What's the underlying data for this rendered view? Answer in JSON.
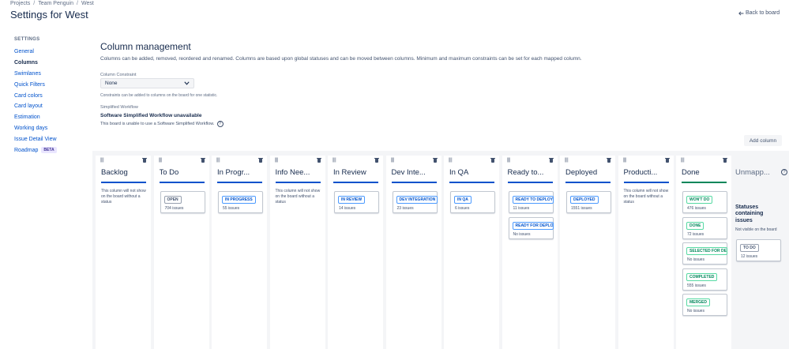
{
  "breadcrumb": [
    "Projects",
    "Team Penguin",
    "West"
  ],
  "breadcrumb_sep": "/",
  "page_title": "Settings for West",
  "back_link": {
    "icon": "arrow-left-icon",
    "label": "Back to board"
  },
  "sidebar": {
    "heading": "SETTINGS",
    "items": [
      {
        "label": "General"
      },
      {
        "label": "Columns",
        "active": true
      },
      {
        "label": "Swimlanes"
      },
      {
        "label": "Quick Filters"
      },
      {
        "label": "Card colors"
      },
      {
        "label": "Card layout"
      },
      {
        "label": "Estimation"
      },
      {
        "label": "Working days"
      },
      {
        "label": "Issue Detail View"
      },
      {
        "label": "Roadmap",
        "badge": "BETA"
      }
    ]
  },
  "main": {
    "title": "Column management",
    "description": "Columns can be added, removed, reordered and renamed. Columns are based upon global statuses and can be moved between columns. Minimum and maximum constraints can be set for each mapped column.",
    "constraint_label": "Column Constraint",
    "constraint_value": "None",
    "constraint_help": "Constraints can be added to columns on the board for one statistic.",
    "workflow_label": "Simplified Workflow",
    "workflow_title": "Software Simplified Workflow unavailable",
    "workflow_text": "This board is unable to use a Software Simplified Workflow.",
    "add_column": "Add column"
  },
  "columns": [
    {
      "title": "Backlog",
      "note": "This column will not show on the board without a status",
      "statuses": []
    },
    {
      "title": "To Do",
      "statuses": [
        {
          "label": "OPEN",
          "count": "704 issues",
          "kind": "todo"
        }
      ]
    },
    {
      "title": "In Progr...",
      "statuses": [
        {
          "label": "IN PROGRESS",
          "count": "55 issues",
          "kind": "prog"
        }
      ]
    },
    {
      "title": "Info Nee...",
      "note": "This column will not show on the board without a status",
      "statuses": []
    },
    {
      "title": "In Review",
      "statuses": [
        {
          "label": "IN REVIEW",
          "count": "14 issues",
          "kind": "prog"
        }
      ]
    },
    {
      "title": "Dev Inte...",
      "statuses": [
        {
          "label": "DEV INTEGRATION",
          "count": "23 issues",
          "kind": "prog"
        }
      ]
    },
    {
      "title": "In QA",
      "statuses": [
        {
          "label": "IN QA",
          "count": "6 issues",
          "kind": "prog"
        }
      ]
    },
    {
      "title": "Ready to...",
      "statuses": [
        {
          "label": "READY TO DEPLOY",
          "count": "11 issues",
          "kind": "prog"
        },
        {
          "label": "READY FOR DEPLOY",
          "count": "No issues",
          "kind": "prog"
        }
      ]
    },
    {
      "title": "Deployed",
      "statuses": [
        {
          "label": "DEPLOYED",
          "count": "1551 issues",
          "kind": "prog"
        }
      ]
    },
    {
      "title": "Producti...",
      "note": "This column will not show on the board without a status",
      "statuses": []
    },
    {
      "title": "Done",
      "done": true,
      "statuses": [
        {
          "label": "WON'T DO",
          "count": "476 issues",
          "kind": "done"
        },
        {
          "label": "DONE",
          "count": "72 issues",
          "kind": "done"
        },
        {
          "label": "SELECTED FOR DEVELOPMENT",
          "count": "No issues",
          "kind": "done"
        },
        {
          "label": "COMPLETED",
          "count": "555 issues",
          "kind": "done"
        },
        {
          "label": "MERGED",
          "count": "No issues",
          "kind": "done"
        }
      ]
    }
  ],
  "unmapped": {
    "title": "Unmapp...",
    "heading": "Statuses containing issues",
    "sub": "Not visible on the board",
    "statuses": [
      {
        "label": "TO DO",
        "count": "12 issues",
        "kind": "todo"
      }
    ]
  }
}
